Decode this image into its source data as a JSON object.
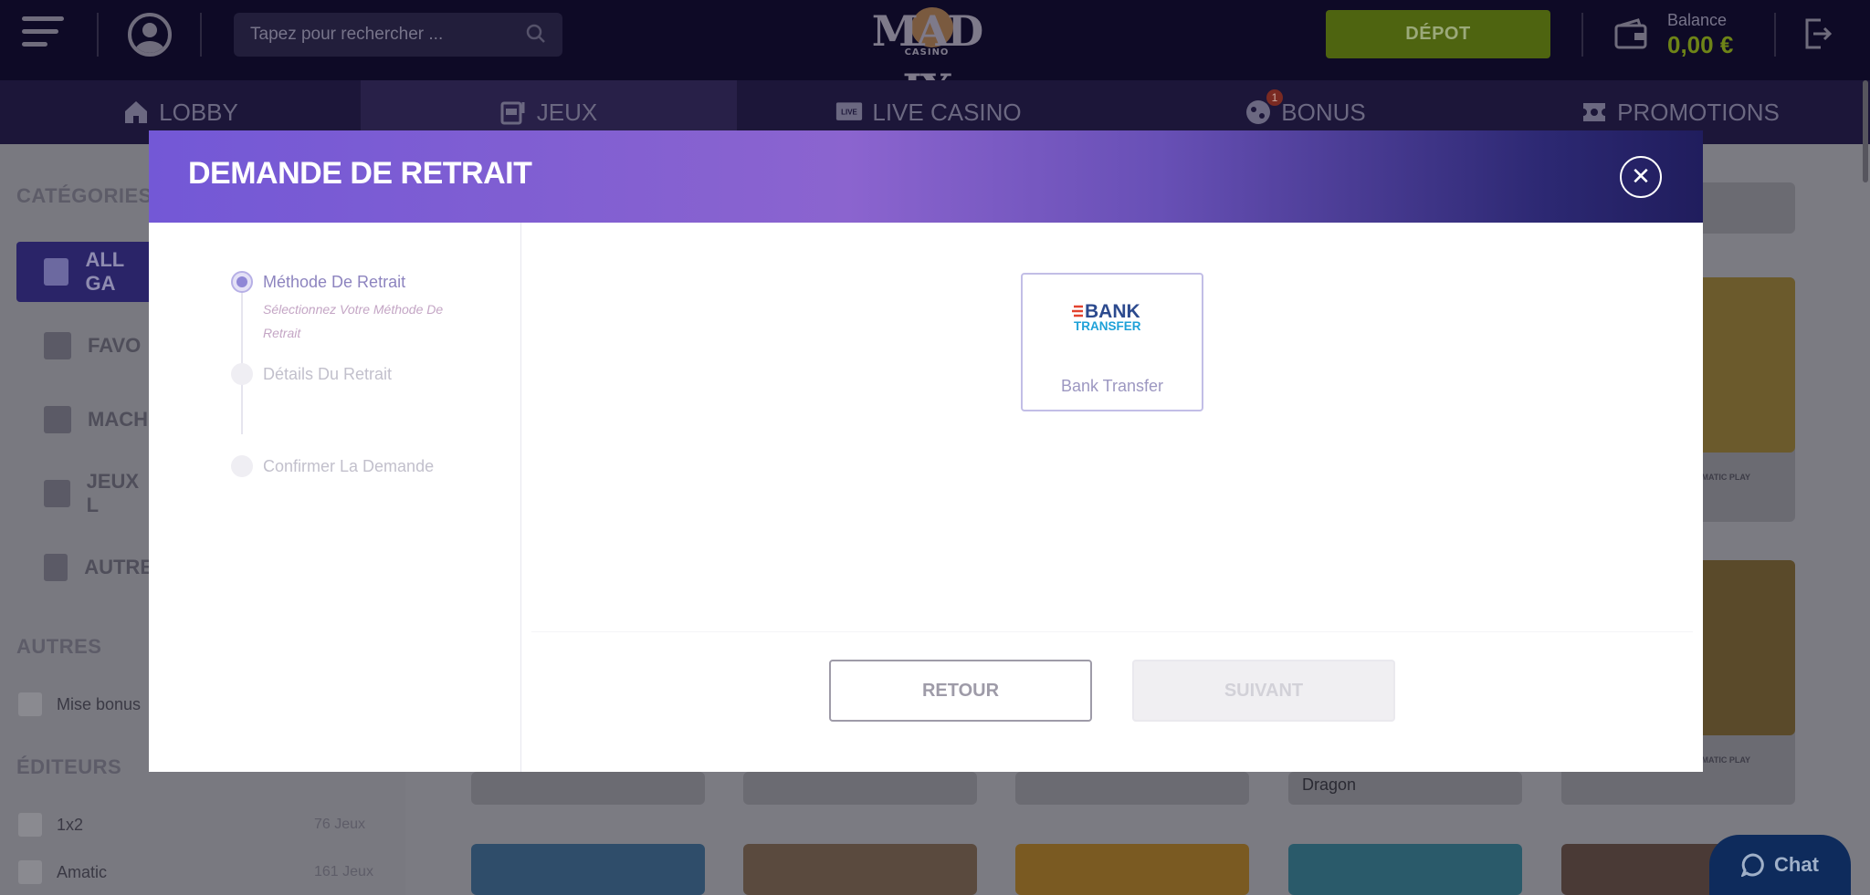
{
  "header": {
    "search_placeholder": "Tapez pour rechercher ...",
    "logo_text": "MAD IX",
    "logo_sub": "CASINO",
    "deposit_label": "DÉPOT",
    "balance_label": "Balance",
    "balance_value": "0,00 €"
  },
  "nav": {
    "items": [
      {
        "label": "LOBBY",
        "icon": "home-icon"
      },
      {
        "label": "JEUX",
        "icon": "slot-machine-icon",
        "active": true
      },
      {
        "label": "LIVE CASINO",
        "icon": "live-icon"
      },
      {
        "label": "BONUS",
        "icon": "bonus-icon",
        "badge": "1"
      },
      {
        "label": "PROMOTIONS",
        "icon": "ticket-icon"
      }
    ]
  },
  "sidebar": {
    "categories_title": "CATÉGORIES",
    "categories": [
      "ALL GA",
      "FAVO",
      "MACH",
      "JEUX L",
      "AUTRE"
    ],
    "others_title": "AUTRES",
    "bonus_checkbox": "Mise bonus",
    "editors_title": "ÉDITEURS",
    "editors": [
      {
        "name": "1x2",
        "count": "76 Jeux"
      },
      {
        "name": "Amatic",
        "count": "161 Jeux"
      }
    ]
  },
  "background_games": {
    "card_title": "Dragon",
    "provider": "AGMATIC PLAY"
  },
  "modal": {
    "title": "DEMANDE DE RETRAIT",
    "close_symbol": "✕",
    "steps": [
      {
        "label": "Méthode De Retrait",
        "sub": "Sélectionnez Votre Méthode De Retrait"
      },
      {
        "label": "Détails Du Retrait"
      },
      {
        "label": "Confirmer La Demande"
      }
    ],
    "method": {
      "label": "Bank Transfer",
      "logo_line1": "BANK",
      "logo_line2": "TRANSFER"
    },
    "back_label": "RETOUR",
    "next_label": "SUIVANT"
  },
  "chat": {
    "label": "Chat"
  },
  "colors": {
    "brand_gradient_start": "#7358d6",
    "brand_gradient_end": "#201d5d",
    "deposit": "#4e6410",
    "step_active": "#8f87d6"
  }
}
